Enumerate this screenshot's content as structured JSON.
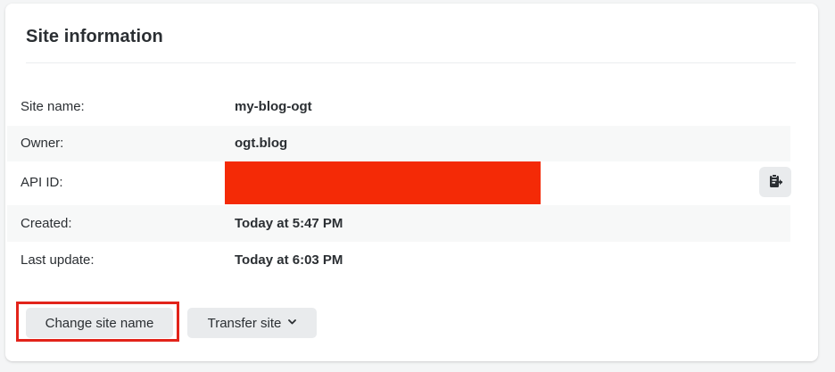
{
  "card": {
    "title": "Site information"
  },
  "rows": [
    {
      "label": "Site name:",
      "value": "my-blog-ogt"
    },
    {
      "label": "Owner:",
      "value": "ogt.blog"
    },
    {
      "label": "API ID:",
      "value": ""
    },
    {
      "label": "Created:",
      "value": "Today at 5:47 PM"
    },
    {
      "label": "Last update:",
      "value": "Today at 6:03 PM"
    }
  ],
  "actions": {
    "change_site_name": "Change site name",
    "transfer_site": "Transfer site"
  },
  "icons": {
    "copy": "clipboard-copy-icon",
    "dropdown": "chevron-down-icon"
  },
  "colors": {
    "redaction": "#f42a06",
    "highlight": "#e2231a",
    "button_bg": "#e9ebed"
  }
}
